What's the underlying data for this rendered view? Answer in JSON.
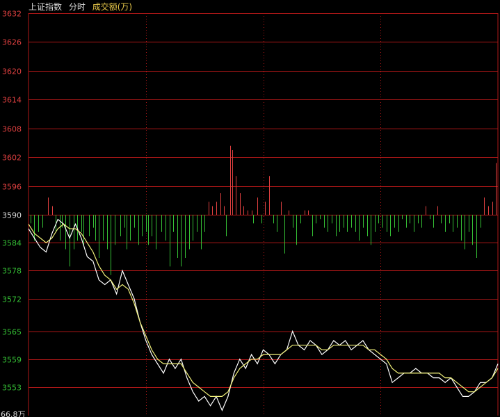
{
  "header": {
    "title": "上证指数",
    "period": "分时",
    "volume_label": "成交额(万)"
  },
  "colors": {
    "background": "#000000",
    "grid": "#b01818",
    "price_line": "#ffffff",
    "avg_line": "#f0f07a",
    "up": "#e04040",
    "down": "#35c035",
    "axis_text_up": "#e04040",
    "axis_text_down": "#35c035"
  },
  "chart_data": {
    "type": "line",
    "title": "上证指数",
    "ylim": [
      3550,
      3632
    ],
    "baseline": 3590,
    "yticks": [
      "3632",
      "3626",
      "3620",
      "3614",
      "3608",
      "3602",
      "3596",
      "3590",
      "3584",
      "3578",
      "3572",
      "3565",
      "3559",
      "3553"
    ],
    "bottom_label": "66.8万",
    "minutes": 240,
    "series": [
      {
        "name": "price",
        "points": [
          [
            0,
            3587
          ],
          [
            3,
            3585
          ],
          [
            6,
            3583
          ],
          [
            9,
            3582
          ],
          [
            12,
            3586
          ],
          [
            15,
            3589
          ],
          [
            18,
            3588
          ],
          [
            21,
            3585
          ],
          [
            24,
            3588
          ],
          [
            27,
            3585
          ],
          [
            30,
            3581
          ],
          [
            33,
            3580
          ],
          [
            36,
            3576
          ],
          [
            39,
            3575
          ],
          [
            42,
            3576
          ],
          [
            45,
            3573
          ],
          [
            48,
            3578
          ],
          [
            51,
            3575
          ],
          [
            54,
            3572
          ],
          [
            57,
            3567
          ],
          [
            60,
            3563
          ],
          [
            63,
            3560
          ],
          [
            66,
            3558
          ],
          [
            69,
            3556
          ],
          [
            72,
            3559
          ],
          [
            75,
            3557
          ],
          [
            78,
            3559
          ],
          [
            81,
            3555
          ],
          [
            84,
            3552
          ],
          [
            87,
            3550
          ],
          [
            90,
            3551
          ],
          [
            93,
            3549
          ],
          [
            96,
            3551
          ],
          [
            99,
            3548
          ],
          [
            102,
            3551
          ],
          [
            105,
            3556
          ],
          [
            108,
            3559
          ],
          [
            111,
            3557
          ],
          [
            114,
            3560
          ],
          [
            117,
            3558
          ],
          [
            120,
            3561
          ],
          [
            123,
            3560
          ],
          [
            126,
            3558
          ],
          [
            129,
            3560
          ],
          [
            132,
            3561
          ],
          [
            135,
            3565
          ],
          [
            138,
            3562
          ],
          [
            141,
            3561
          ],
          [
            144,
            3563
          ],
          [
            147,
            3562
          ],
          [
            150,
            3560
          ],
          [
            153,
            3561
          ],
          [
            156,
            3563
          ],
          [
            159,
            3562
          ],
          [
            162,
            3563
          ],
          [
            165,
            3561
          ],
          [
            168,
            3562
          ],
          [
            171,
            3563
          ],
          [
            174,
            3561
          ],
          [
            177,
            3560
          ],
          [
            180,
            3559
          ],
          [
            183,
            3558
          ],
          [
            186,
            3554
          ],
          [
            189,
            3555
          ],
          [
            192,
            3556
          ],
          [
            195,
            3556
          ],
          [
            198,
            3557
          ],
          [
            201,
            3556
          ],
          [
            204,
            3556
          ],
          [
            207,
            3555
          ],
          [
            210,
            3555
          ],
          [
            213,
            3554
          ],
          [
            216,
            3555
          ],
          [
            219,
            3553
          ],
          [
            222,
            3551
          ],
          [
            225,
            3551
          ],
          [
            228,
            3552
          ],
          [
            231,
            3554
          ],
          [
            234,
            3554
          ],
          [
            237,
            3555
          ],
          [
            240,
            3558
          ]
        ]
      },
      {
        "name": "average",
        "points": [
          [
            0,
            3588
          ],
          [
            3,
            3586
          ],
          [
            6,
            3585
          ],
          [
            9,
            3584
          ],
          [
            12,
            3585
          ],
          [
            15,
            3587
          ],
          [
            18,
            3588
          ],
          [
            21,
            3587
          ],
          [
            24,
            3587
          ],
          [
            27,
            3586
          ],
          [
            30,
            3584
          ],
          [
            33,
            3582
          ],
          [
            36,
            3579
          ],
          [
            39,
            3577
          ],
          [
            42,
            3576
          ],
          [
            45,
            3574
          ],
          [
            48,
            3575
          ],
          [
            51,
            3574
          ],
          [
            54,
            3571
          ],
          [
            57,
            3567
          ],
          [
            60,
            3564
          ],
          [
            63,
            3561
          ],
          [
            66,
            3559
          ],
          [
            69,
            3558
          ],
          [
            72,
            3558
          ],
          [
            75,
            3558
          ],
          [
            78,
            3558
          ],
          [
            81,
            3556
          ],
          [
            84,
            3554
          ],
          [
            87,
            3553
          ],
          [
            90,
            3552
          ],
          [
            93,
            3551
          ],
          [
            96,
            3551
          ],
          [
            99,
            3551
          ],
          [
            102,
            3552
          ],
          [
            105,
            3555
          ],
          [
            108,
            3557
          ],
          [
            111,
            3558
          ],
          [
            114,
            3559
          ],
          [
            117,
            3559
          ],
          [
            120,
            3560
          ],
          [
            123,
            3560
          ],
          [
            126,
            3560
          ],
          [
            129,
            3560
          ],
          [
            132,
            3561
          ],
          [
            135,
            3562
          ],
          [
            138,
            3562
          ],
          [
            141,
            3562
          ],
          [
            144,
            3562
          ],
          [
            147,
            3562
          ],
          [
            150,
            3561
          ],
          [
            153,
            3561
          ],
          [
            156,
            3562
          ],
          [
            159,
            3562
          ],
          [
            162,
            3562
          ],
          [
            165,
            3562
          ],
          [
            168,
            3562
          ],
          [
            171,
            3562
          ],
          [
            174,
            3561
          ],
          [
            177,
            3561
          ],
          [
            180,
            3560
          ],
          [
            183,
            3559
          ],
          [
            186,
            3557
          ],
          [
            189,
            3556
          ],
          [
            192,
            3556
          ],
          [
            195,
            3556
          ],
          [
            198,
            3556
          ],
          [
            201,
            3556
          ],
          [
            204,
            3556
          ],
          [
            207,
            3556
          ],
          [
            210,
            3556
          ],
          [
            213,
            3555
          ],
          [
            216,
            3555
          ],
          [
            219,
            3554
          ],
          [
            222,
            3553
          ],
          [
            225,
            3552
          ],
          [
            228,
            3552
          ],
          [
            231,
            3553
          ],
          [
            234,
            3554
          ],
          [
            237,
            3555
          ],
          [
            240,
            3557
          ]
        ]
      }
    ],
    "volume_bars": [
      [
        1,
        -2
      ],
      [
        3,
        -6
      ],
      [
        5,
        -4
      ],
      [
        7,
        -3
      ],
      [
        10,
        4
      ],
      [
        12,
        2
      ],
      [
        14,
        -4
      ],
      [
        16,
        -6
      ],
      [
        17,
        -3
      ],
      [
        19,
        -8
      ],
      [
        21,
        -12
      ],
      [
        23,
        -8
      ],
      [
        25,
        -6
      ],
      [
        27,
        -4
      ],
      [
        28,
        -7
      ],
      [
        31,
        -5
      ],
      [
        33,
        -3
      ],
      [
        34,
        -6
      ],
      [
        36,
        -10
      ],
      [
        38,
        -6
      ],
      [
        40,
        -8
      ],
      [
        42,
        -14
      ],
      [
        44,
        -7
      ],
      [
        47,
        -5
      ],
      [
        49,
        -3
      ],
      [
        50,
        -8
      ],
      [
        52,
        -6
      ],
      [
        54,
        -3
      ],
      [
        56,
        -7
      ],
      [
        58,
        -5
      ],
      [
        60,
        -4
      ],
      [
        61,
        -7
      ],
      [
        63,
        -5
      ],
      [
        65,
        -8
      ],
      [
        68,
        -4
      ],
      [
        70,
        -6
      ],
      [
        72,
        -12
      ],
      [
        74,
        -4
      ],
      [
        76,
        -10
      ],
      [
        78,
        -12
      ],
      [
        80,
        -10
      ],
      [
        82,
        -8
      ],
      [
        84,
        -6
      ],
      [
        86,
        -4
      ],
      [
        88,
        -8
      ],
      [
        90,
        -4
      ],
      [
        92,
        3
      ],
      [
        94,
        2
      ],
      [
        96,
        3
      ],
      [
        98,
        5
      ],
      [
        100,
        2
      ],
      [
        101,
        -5
      ],
      [
        103,
        16
      ],
      [
        104,
        15
      ],
      [
        106,
        9
      ],
      [
        108,
        5
      ],
      [
        110,
        2
      ],
      [
        112,
        1
      ],
      [
        114,
        1
      ],
      [
        115,
        -2
      ],
      [
        117,
        4
      ],
      [
        119,
        -2
      ],
      [
        121,
        3
      ],
      [
        123,
        9
      ],
      [
        125,
        -2
      ],
      [
        127,
        -4
      ],
      [
        129,
        3
      ],
      [
        131,
        -9
      ],
      [
        133,
        1
      ],
      [
        135,
        -3
      ],
      [
        137,
        -7
      ],
      [
        139,
        -2
      ],
      [
        141,
        1
      ],
      [
        143,
        1
      ],
      [
        145,
        -5
      ],
      [
        147,
        -2
      ],
      [
        149,
        -1
      ],
      [
        151,
        -3
      ],
      [
        153,
        -4
      ],
      [
        155,
        -2
      ],
      [
        157,
        -5
      ],
      [
        159,
        -4
      ],
      [
        161,
        -3
      ],
      [
        163,
        -4
      ],
      [
        165,
        -3
      ],
      [
        167,
        -4
      ],
      [
        169,
        -6
      ],
      [
        171,
        -3
      ],
      [
        173,
        -5
      ],
      [
        175,
        -7
      ],
      [
        177,
        -4
      ],
      [
        179,
        -2
      ],
      [
        181,
        -3
      ],
      [
        183,
        -4
      ],
      [
        185,
        -5
      ],
      [
        187,
        -3
      ],
      [
        189,
        -4
      ],
      [
        191,
        -1
      ],
      [
        193,
        -3
      ],
      [
        195,
        -2
      ],
      [
        197,
        -4
      ],
      [
        199,
        -2
      ],
      [
        201,
        -3
      ],
      [
        203,
        2
      ],
      [
        205,
        -1
      ],
      [
        207,
        -3
      ],
      [
        209,
        2
      ],
      [
        211,
        -2
      ],
      [
        213,
        -4
      ],
      [
        215,
        -2
      ],
      [
        217,
        -4
      ],
      [
        219,
        -3
      ],
      [
        221,
        -6
      ],
      [
        223,
        -8
      ],
      [
        225,
        -4
      ],
      [
        227,
        -7
      ],
      [
        229,
        -10
      ],
      [
        231,
        -3
      ],
      [
        233,
        4
      ],
      [
        235,
        2
      ],
      [
        237,
        3
      ],
      [
        239,
        12
      ]
    ]
  }
}
